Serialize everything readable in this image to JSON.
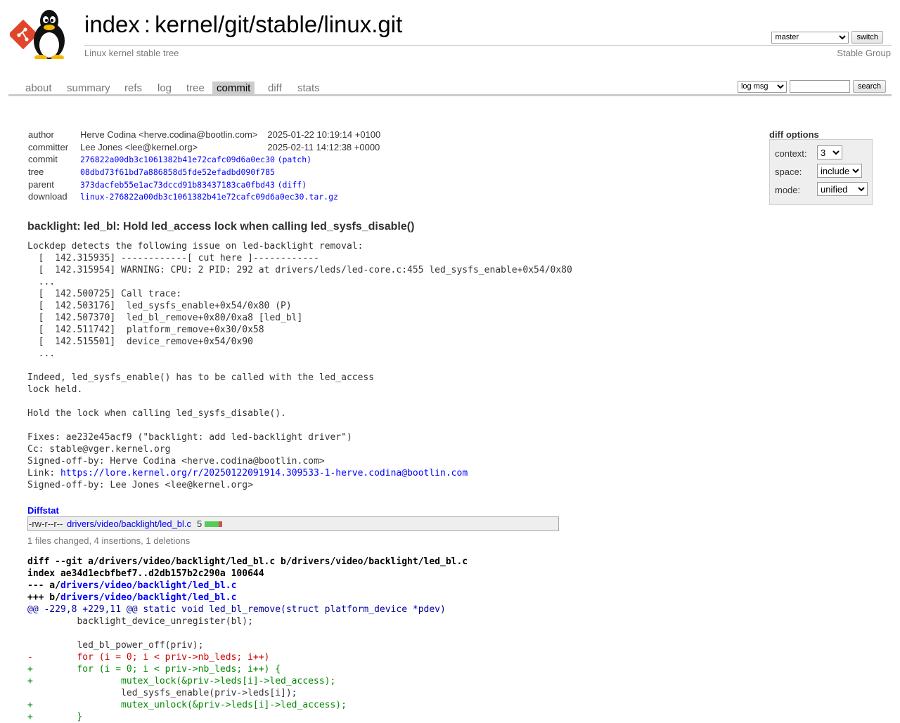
{
  "header": {
    "title_index": "index",
    "title_sep": ":",
    "title_repo": "kernel/git/stable/linux.git",
    "description": "Linux kernel stable tree",
    "owner": "Stable Group",
    "branch": {
      "selected": "master",
      "switch_label": "switch"
    }
  },
  "tabs": [
    "about",
    "summary",
    "refs",
    "log",
    "tree",
    "commit",
    "diff",
    "stats"
  ],
  "active_tab": "commit",
  "search": {
    "mode_selected": "log msg",
    "query": "",
    "button_label": "search"
  },
  "commit": {
    "author_label": "author",
    "author": "Herve Codina <herve.codina@bootlin.com>",
    "author_date": "2025-01-22 10:19:14 +0100",
    "committer_label": "committer",
    "committer": "Lee Jones <lee@kernel.org>",
    "committer_date": "2025-02-11 14:12:38 +0000",
    "commit_label": "commit",
    "commit_sha": "276822a00db3c1061382b41e72cafc09d6a0ec30",
    "commit_extra": "(patch)",
    "tree_label": "tree",
    "tree_sha": "08dbd73f61bd7a886858d5fde52efadbd090f785",
    "parent_label": "parent",
    "parent_sha": "373dacfeb55e1ac73dccd91b83437183ca0fbd43",
    "parent_extra": "(diff)",
    "download_label": "download",
    "download_file": "linux-276822a00db3c1061382b41e72cafc09d6a0ec30.tar.gz"
  },
  "diff_options": {
    "title": "diff options",
    "context_label": "context:",
    "context_value": "3",
    "space_label": "space:",
    "space_value": "include",
    "mode_label": "mode:",
    "mode_value": "unified"
  },
  "subject": "backlight: led_bl: Hold led_access lock when calling led_sysfs_disable()",
  "message": {
    "body": "Lockdep detects the following issue on led-backlight removal:\n  [  142.315935] ------------[ cut here ]------------\n  [  142.315954] WARNING: CPU: 2 PID: 292 at drivers/leds/led-core.c:455 led_sysfs_enable+0x54/0x80\n  ...\n  [  142.500725] Call trace:\n  [  142.503176]  led_sysfs_enable+0x54/0x80 (P)\n  [  142.507370]  led_bl_remove+0x80/0xa8 [led_bl]\n  [  142.511742]  platform_remove+0x30/0x58\n  [  142.515501]  device_remove+0x54/0x90\n  ...\n\nIndeed, led_sysfs_enable() has to be called with the led_access\nlock held.\n\nHold the lock when calling led_sysfs_disable().\n\nFixes: ae232e45acf9 (\"backlight: add led-backlight driver\")\nCc: stable@vger.kernel.org\nSigned-off-by: Herve Codina <herve.codina@bootlin.com>\nLink: ",
    "link": "https://lore.kernel.org/r/20250122091914.309533-1-herve.codina@bootlin.com",
    "tail": "\nSigned-off-by: Lee Jones <lee@kernel.org>"
  },
  "diffstat": {
    "header": "Diffstat",
    "mode": "-rw-r--r--",
    "file": "drivers/video/backlight/led_bl.c",
    "count": "5",
    "insertions": 4,
    "deletions": 1,
    "summary": "1 files changed, 4 insertions, 1 deletions"
  },
  "diff": {
    "git_line": "diff --git a/drivers/video/backlight/led_bl.c b/drivers/video/backlight/led_bl.c",
    "index_line": "index ae34d1ecbfbef7..d2db157b2c290a 100644",
    "minus_prefix": "--- a/",
    "minus_file": "drivers/video/backlight/led_bl.c",
    "plus_prefix": "+++ b/",
    "plus_file": "drivers/video/backlight/led_bl.c",
    "hunk": "@@ -229,8 +229,11 @@ static void led_bl_remove(struct platform_device *pdev)",
    "lines": [
      {
        "type": "ctx",
        "text": " \tbacklight_device_unregister(bl);"
      },
      {
        "type": "ctx",
        "text": " "
      },
      {
        "type": "ctx",
        "text": " \tled_bl_power_off(priv);"
      },
      {
        "type": "del",
        "text": "-\tfor (i = 0; i < priv->nb_leds; i++)"
      },
      {
        "type": "add",
        "text": "+\tfor (i = 0; i < priv->nb_leds; i++) {"
      },
      {
        "type": "add",
        "text": "+\t\tmutex_lock(&priv->leds[i]->led_access);"
      },
      {
        "type": "ctx",
        "text": " \t\tled_sysfs_enable(priv->leds[i]);"
      },
      {
        "type": "add",
        "text": "+\t\tmutex_unlock(&priv->leds[i]->led_access);"
      },
      {
        "type": "add",
        "text": "+\t}"
      }
    ]
  }
}
